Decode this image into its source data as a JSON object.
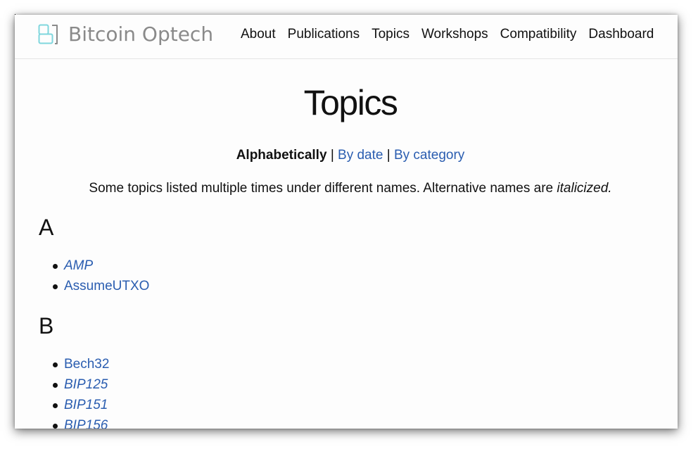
{
  "header": {
    "logo_text": "Bitcoin Optech",
    "nav": [
      "About",
      "Publications",
      "Topics",
      "Workshops",
      "Compatibility",
      "Dashboard"
    ]
  },
  "page": {
    "title": "Topics",
    "sort": {
      "current": "Alphabetically",
      "separator": "|",
      "by_date": "By date",
      "by_category": "By category"
    },
    "note": {
      "text": "Some topics listed multiple times under different names. Alternative names are ",
      "italic": "italicized."
    }
  },
  "sections": [
    {
      "letter": "A",
      "items": [
        {
          "label": "AMP",
          "alt": true
        },
        {
          "label": "AssumeUTXO",
          "alt": false
        }
      ]
    },
    {
      "letter": "B",
      "items": [
        {
          "label": "Bech32",
          "alt": false
        },
        {
          "label": "BIP125",
          "alt": true
        },
        {
          "label": "BIP151",
          "alt": true
        },
        {
          "label": "BIP156",
          "alt": true
        }
      ]
    }
  ],
  "colors": {
    "link": "#2a5db0",
    "logo_text": "#8a8a8a",
    "logo_accent": "#7fd6dd"
  }
}
